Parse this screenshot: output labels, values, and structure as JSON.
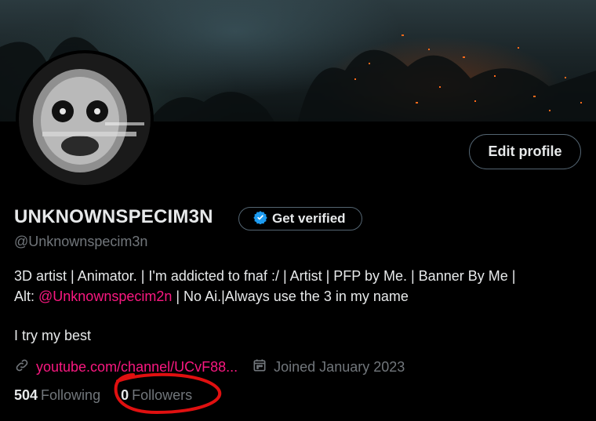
{
  "profile": {
    "display_name": "UNKNOWNSPECIM3N",
    "handle": "@Unknownspecim3n",
    "edit_profile_label": "Edit profile",
    "get_verified_label": "Get verified",
    "bio": {
      "line1": "3D artist | Animator. | I'm addicted to fnaf :/ | Artist | PFP by Me. | Banner By Me |",
      "line2_prefix": "Alt: ",
      "line2_mention": "@Unknownspecim2n",
      "line2_suffix": " | No Ai.|Always use the 3 in my name",
      "line3": "I try my best"
    },
    "website": "youtube.com/channel/UCvF88...",
    "joined": "Joined January 2023",
    "following_count": "504",
    "following_label": "Following",
    "followers_count": "0",
    "followers_label": "Followers"
  },
  "colors": {
    "accent_pink": "#f91880",
    "verified_blue": "#1d9bf0",
    "secondary_text": "#71767b",
    "annotation_red": "#e01010"
  },
  "icons": [
    "link-icon",
    "calendar-icon",
    "verified-badge-icon"
  ]
}
